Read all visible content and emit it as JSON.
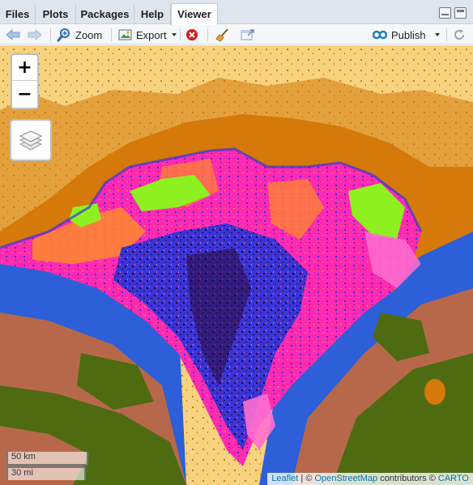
{
  "tabs": [
    {
      "label": "Files"
    },
    {
      "label": "Plots"
    },
    {
      "label": "Packages"
    },
    {
      "label": "Help"
    },
    {
      "label": "Viewer",
      "active": true
    }
  ],
  "toolbar": {
    "zoom_label": "Zoom",
    "export_label": "Export",
    "publish_label": "Publish",
    "icons": [
      "back-arrow-icon",
      "forward-arrow-icon",
      "zoom-icon",
      "export-icon",
      "remove-icon",
      "broom-icon",
      "new-window-icon",
      "publish-icon",
      "refresh-icon"
    ]
  },
  "map": {
    "zoom_in_label": "+",
    "zoom_out_label": "−",
    "scale_km": "50 km",
    "scale_mi": "30 mi",
    "attribution": {
      "leaflet": "Leaflet",
      "sep": " | © ",
      "osm": "OpenStreetMap",
      "contributors": " contributors © ",
      "carto": "CARTO"
    },
    "colors": {
      "sand": "#f7d27f",
      "orange": "#d4790a",
      "magenta": "#ff2ab4",
      "pink": "#ff6fd0",
      "blue": "#3a34d6",
      "dark": "#2a0a3a",
      "green": "#8ef020",
      "brown": "#b8684a",
      "olive": "#4e6b12",
      "royal": "#2c5fd8"
    }
  }
}
